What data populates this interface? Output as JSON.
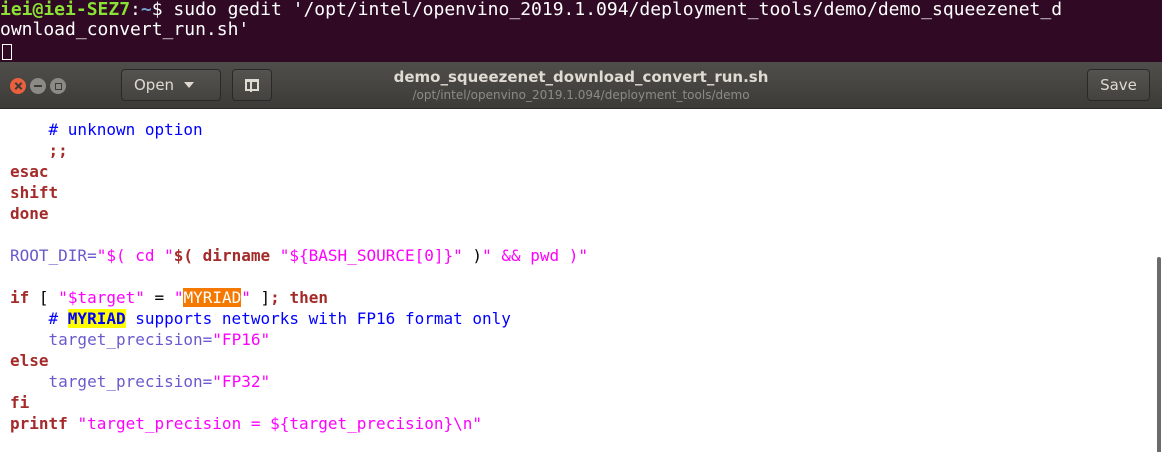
{
  "terminal": {
    "user_host": "iei@iei-SEZ7",
    "separator": ":",
    "cwd": "~",
    "prompt_symbol": "$",
    "command_part1": " sudo gedit '/opt/intel/openvino_2019.1.094/deployment_tools/demo/demo_squeezenet_d",
    "command_part2": "ownload_convert_run.sh'"
  },
  "gedit": {
    "open_label": "Open",
    "save_label": "Save",
    "document_title": "demo_squeezenet_download_convert_run.sh",
    "document_path": "/opt/intel/openvino_2019.1.094/deployment_tools/demo"
  },
  "editor": {
    "lines": [
      "    # unknown option",
      "    ;;",
      "esac",
      "shift",
      "done",
      "",
      "ROOT_DIR=\"$( cd \"$( dirname \"${BASH_SOURCE[0]}\" )\" && pwd )\"",
      "",
      "if [ \"$target\" = \"MYRIAD\" ]; then",
      "    # MYRIAD supports networks with FP16 format only",
      "    target_precision=\"FP16\"",
      "else",
      "    target_precision=\"FP32\"",
      "fi",
      "printf \"target_precision = ${target_precision}\\n\""
    ],
    "search_term": "MYRIAD"
  },
  "colors": {
    "terminal_bg": "#300a24",
    "keyword": "#a52a2a",
    "comment": "#0000ff",
    "string": "#ff00ff",
    "variable": "#6a5acd",
    "search_highlight": "#f57900",
    "todo_highlight": "#ffff00"
  }
}
